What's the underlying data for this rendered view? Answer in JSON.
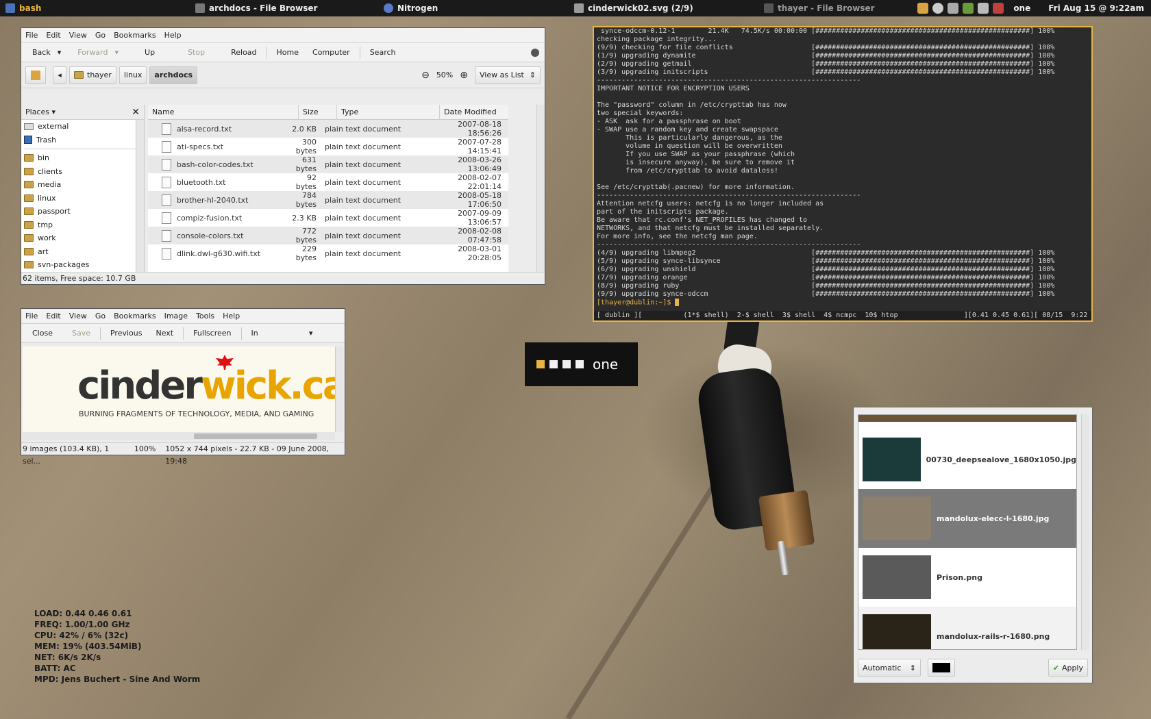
{
  "topbar": {
    "tasks": [
      "bash",
      "archdocs - File Browser",
      "Nitrogen",
      "cinderwick02.svg  (2/9)",
      "thayer - File Browser"
    ],
    "workspace": "one",
    "clock": "Fri Aug 15 @ 9:22am"
  },
  "file_browser": {
    "menu": [
      "File",
      "Edit",
      "View",
      "Go",
      "Bookmarks",
      "Help"
    ],
    "toolbar": {
      "back": "Back",
      "forward": "Forward",
      "up": "Up",
      "stop": "Stop",
      "reload": "Reload",
      "home": "Home",
      "computer": "Computer",
      "search": "Search"
    },
    "breadcrumbs": [
      "thayer",
      "linux",
      "archdocs"
    ],
    "zoom": "50%",
    "view_mode": "View as List",
    "places_label": "Places",
    "places": [
      "external",
      "Trash",
      "bin",
      "clients",
      "media",
      "linux",
      "passport",
      "tmp",
      "work",
      "art",
      "svn-packages"
    ],
    "columns": [
      "Name",
      "Size",
      "Type",
      "Date Modified"
    ],
    "files": [
      {
        "name": "alsa-record.txt",
        "size": "2.0 KB",
        "type": "plain text document",
        "date": "2007-08-18 18:56:26"
      },
      {
        "name": "ati-specs.txt",
        "size": "300 bytes",
        "type": "plain text document",
        "date": "2007-07-28 14:15:41"
      },
      {
        "name": "bash-color-codes.txt",
        "size": "631 bytes",
        "type": "plain text document",
        "date": "2008-03-26 13:06:49"
      },
      {
        "name": "bluetooth.txt",
        "size": "92 bytes",
        "type": "plain text document",
        "date": "2008-02-07 22:01:14"
      },
      {
        "name": "brother-hl-2040.txt",
        "size": "784 bytes",
        "type": "plain text document",
        "date": "2008-05-18 17:06:50"
      },
      {
        "name": "compiz-fusion.txt",
        "size": "2.3 KB",
        "type": "plain text document",
        "date": "2007-09-09 13:06:57"
      },
      {
        "name": "console-colors.txt",
        "size": "772 bytes",
        "type": "plain text document",
        "date": "2008-02-08 07:47:58"
      },
      {
        "name": "dlink.dwl-g630.wifi.txt",
        "size": "229 bytes",
        "type": "plain text document",
        "date": "2008-03-01 20:28:05"
      }
    ],
    "status": "62 items, Free space: 10.7 GB"
  },
  "terminal": {
    "lines": [
      " synce-odccm-0.12-1        21.4K   74.5K/s 00:00:00 [####################################################] 100%",
      "checking package integrity...",
      "(9/9) checking for file conflicts                   [####################################################] 100%",
      "(1/9) upgrading dynamite                            [####################################################] 100%",
      "(2/9) upgrading getmail                             [####################################################] 100%",
      "(3/9) upgrading initscripts                         [####################################################] 100%",
      "----------------------------------------------------------------",
      "IMPORTANT NOTICE FOR ENCRYPTION USERS",
      "",
      "The \"password\" column in /etc/crypttab has now",
      "two special keywords:",
      "- ASK  ask for a passphrase on boot",
      "- SWAP use a random key and create swapspace",
      "       This is particularly dangerous, as the",
      "       volume in question will be overwritten",
      "       If you use SWAP as your passphrase (which",
      "       is insecure anyway), be sure to remove it",
      "       from /etc/crypttab to avoid dataloss!",
      "",
      "See /etc/crypttab(.pacnew) for more information.",
      "----------------------------------------------------------------",
      "Attention netcfg users: netcfg is no longer included as",
      "part of the initscripts package.",
      "Be aware that rc.conf's NET_PROFILES has changed to",
      "NETWORKS, and that netcfg must be installed separately.",
      "For more info, see the netcfg man page.",
      "----------------------------------------------------------------",
      "(4/9) upgrading libmpeg2                            [####################################################] 100%",
      "(5/9) upgrading synce-libsynce                      [####################################################] 100%",
      "(6/9) upgrading unshield                            [####################################################] 100%",
      "(7/9) upgrading orange                              [####################################################] 100%",
      "(8/9) upgrading ruby                                [####################################################] 100%",
      "(9/9) upgrading synce-odccm                         [####################################################] 100%",
      "[thayer@dublin:~]$ "
    ],
    "statusline": "[ dublin ][          (1*$ shell)  2-$ shell  3$ shell  4$ ncmpc  10$ htop                ][0.41 0.45 0.61][ 08/15  9:22 ]"
  },
  "workspace_osd": {
    "label": "one",
    "active_index": 0,
    "count": 4
  },
  "image_viewer": {
    "menu": [
      "File",
      "Edit",
      "View",
      "Go",
      "Bookmarks",
      "Image",
      "Tools",
      "Help"
    ],
    "toolbar": {
      "close": "Close",
      "save": "Save",
      "previous": "Previous",
      "next": "Next",
      "fullscreen": "Fullscreen",
      "zoom_mode": "In"
    },
    "logo_left": "cinder",
    "logo_right": "wick.ca",
    "tagline": "BURNING FRAGMENTS OF TECHNOLOGY, MEDIA, AND GAMING",
    "status_count": "9 images (103.4 KB), 1 sel...",
    "status_zoom": "100%",
    "status_info": "1052 x 744 pixels - 22.7 KB - 09 June 2008, 19:48"
  },
  "sysmon": [
    "LOAD: 0.44 0.46 0.61",
    "FREQ: 1.00/1.00 GHz",
    "CPU:   42% / 6%  (32c)",
    "MEM:  19% (403.54MiB)",
    "NET:    6K/s  2K/s",
    "BATT: AC",
    "MPD:  Jens Buchert - Sine And Worm"
  ],
  "nitrogen": {
    "items": [
      {
        "name": "00730_deepsealove_1680x1050.jpg",
        "color": "#1b3a3a"
      },
      {
        "name": "mandolux-elecc-l-1680.jpg",
        "color": "#8c7f6b"
      },
      {
        "name": "Prison.png",
        "color": "#5a5a5a"
      },
      {
        "name": "mandolux-rails-r-1680.png",
        "color": "#2a2418"
      }
    ],
    "mode": "Automatic",
    "apply": "Apply"
  }
}
